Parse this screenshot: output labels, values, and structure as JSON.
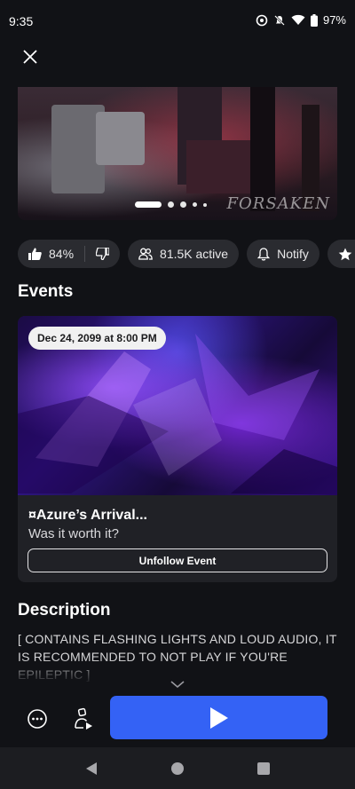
{
  "status_bar": {
    "time": "9:35",
    "battery": "97%"
  },
  "hero": {
    "watermark": "FORSAKEN",
    "slide_count": 6,
    "active_slide": 1
  },
  "chips": {
    "like_percent": "84%",
    "active": "81.5K active",
    "notify": "Notify",
    "favorite": "Fa"
  },
  "events": {
    "heading": "Events",
    "date": "Dec 24, 2099 at 8:00 PM",
    "title": "¤Azure’s Arrival...",
    "subtitle": "Was it worth it?",
    "unfollow_label": "Unfollow Event"
  },
  "description": {
    "heading": "Description",
    "text": "[ CONTAINS FLASHING LIGHTS AND LOUD AUDIO, IT IS RECOMMENDED TO NOT PLAY IF YOU'RE EPILEPTIC ]"
  },
  "colors": {
    "background": "#111216",
    "chip": "#2a2b30",
    "play_button": "#3462f5"
  },
  "icons": [
    "close-icon",
    "thumbs-up-icon",
    "thumbs-down-icon",
    "people-icon",
    "bell-icon",
    "star-icon",
    "more-icon",
    "party-icon",
    "play-icon",
    "chevron-down-icon"
  ]
}
